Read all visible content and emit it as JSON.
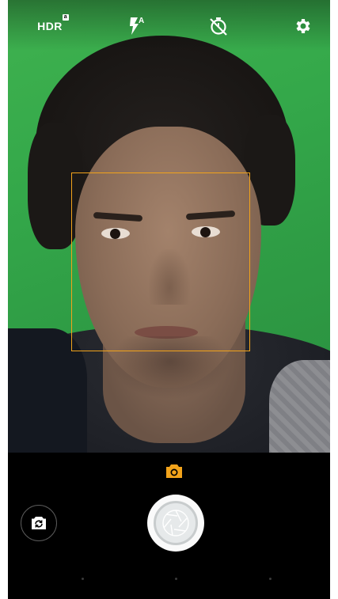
{
  "top_bar": {
    "hdr_label": "HDR",
    "hdr_badge": "a",
    "flash_mode_label": "A",
    "icons": [
      "hdr-icon",
      "flash-auto-icon",
      "timer-off-icon",
      "settings-gear-icon"
    ]
  },
  "viewfinder": {
    "face_detected": true,
    "face_box_color": "#f2a31b"
  },
  "controls": {
    "mode_icon": "camera-icon",
    "mode_accent_color": "#f2a31b",
    "switch_camera_icon": "switch-camera-icon",
    "shutter_icon": "shutter-aperture-icon",
    "page_indicator_count": 3
  }
}
